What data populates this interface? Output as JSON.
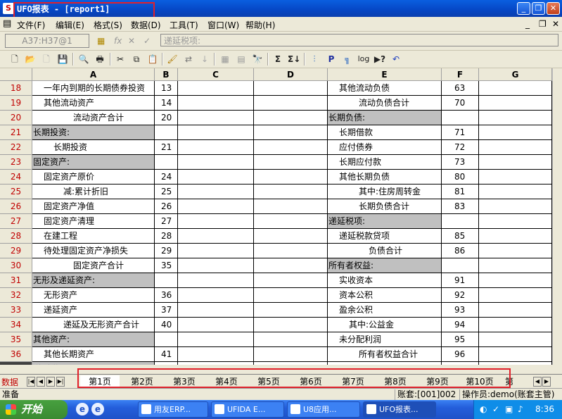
{
  "window": {
    "title": "UFO报表 - [report1]"
  },
  "menu": [
    {
      "label": "文件(F)"
    },
    {
      "label": "编辑(E)"
    },
    {
      "label": "格式(S)"
    },
    {
      "label": "数据(D)"
    },
    {
      "label": "工具(T)"
    },
    {
      "label": "窗口(W)"
    },
    {
      "label": "帮助(H)"
    }
  ],
  "formula_bar": {
    "cell_ref": "A37:H37@1",
    "content": "递延税项:"
  },
  "toolbar_icons": [
    "new-file-icon",
    "open-folder-icon",
    "blank-icon",
    "save-icon",
    "print-preview-icon",
    "print-icon",
    "cut-icon",
    "copy-icon",
    "paste-icon",
    "format-painter-icon",
    "insert-icon",
    "sort-icon",
    "grid-icon",
    "table-icon",
    "find-icon",
    "sum-icon",
    "sum-list-icon",
    "chart-icon",
    "P",
    "pivot-icon",
    "log-icon",
    "help-icon",
    "undo-icon"
  ],
  "grid": {
    "columns": [
      "A",
      "B",
      "C",
      "D",
      "E",
      "F",
      "G"
    ],
    "rows": [
      {
        "n": "18",
        "a": "一年内到期的长期债券投资",
        "ai": 1,
        "ag": false,
        "b": "13",
        "e": "其他流动负债",
        "ei": 1,
        "eg": false,
        "f": "63"
      },
      {
        "n": "19",
        "a": "其他流动资产",
        "ai": 1,
        "ag": false,
        "b": "14",
        "e": "流动负债合计",
        "ei": 3,
        "eg": false,
        "f": "70"
      },
      {
        "n": "20",
        "a": "流动资产合计",
        "ai": 4,
        "ag": false,
        "b": "20",
        "e": "长期负债:",
        "ei": 0,
        "eg": true,
        "f": ""
      },
      {
        "n": "21",
        "a": "长期投资:",
        "ai": 0,
        "ag": true,
        "b": "",
        "e": "长期借款",
        "ei": 1,
        "eg": false,
        "f": "71"
      },
      {
        "n": "22",
        "a": "长期投资",
        "ai": 2,
        "ag": false,
        "b": "21",
        "e": "应付债券",
        "ei": 1,
        "eg": false,
        "f": "72"
      },
      {
        "n": "23",
        "a": "固定资产:",
        "ai": 0,
        "ag": true,
        "b": "",
        "e": "长期应付款",
        "ei": 1,
        "eg": false,
        "f": "73"
      },
      {
        "n": "24",
        "a": "固定资产原价",
        "ai": 1,
        "ag": false,
        "b": "24",
        "e": "其他长期负债",
        "ei": 1,
        "eg": false,
        "f": "80"
      },
      {
        "n": "25",
        "a": "减:累计折旧",
        "ai": 3,
        "ag": false,
        "b": "25",
        "e": "其中:住房周转金",
        "ei": 3,
        "eg": false,
        "f": "81"
      },
      {
        "n": "26",
        "a": "固定资产净值",
        "ai": 1,
        "ag": false,
        "b": "26",
        "e": "长期负债合计",
        "ei": 3,
        "eg": false,
        "f": "83"
      },
      {
        "n": "27",
        "a": "固定资产清理",
        "ai": 1,
        "ag": false,
        "b": "27",
        "e": "递延税项:",
        "ei": 0,
        "eg": true,
        "f": ""
      },
      {
        "n": "28",
        "a": "在建工程",
        "ai": 1,
        "ag": false,
        "b": "28",
        "e": "递延税款贷项",
        "ei": 1,
        "eg": false,
        "f": "85"
      },
      {
        "n": "29",
        "a": "待处理固定资产净损失",
        "ai": 1,
        "ag": false,
        "b": "29",
        "e": "负债合计",
        "ei": 4,
        "eg": false,
        "f": "86"
      },
      {
        "n": "30",
        "a": "固定资产合计",
        "ai": 4,
        "ag": false,
        "b": "35",
        "e": "所有者权益:",
        "ei": 0,
        "eg": true,
        "f": ""
      },
      {
        "n": "31",
        "a": "无形及递延资产:",
        "ai": 0,
        "ag": true,
        "b": "",
        "e": "实收资本",
        "ei": 1,
        "eg": false,
        "f": "91"
      },
      {
        "n": "32",
        "a": "无形资产",
        "ai": 1,
        "ag": false,
        "b": "36",
        "e": "资本公积",
        "ei": 1,
        "eg": false,
        "f": "92"
      },
      {
        "n": "33",
        "a": "递延资产",
        "ai": 1,
        "ag": false,
        "b": "37",
        "e": "盈余公积",
        "ei": 1,
        "eg": false,
        "f": "93"
      },
      {
        "n": "34",
        "a": "递延及无形资产合计",
        "ai": 3,
        "ag": false,
        "b": "40",
        "e": "其中:公益金",
        "ei": 2,
        "eg": false,
        "f": "94"
      },
      {
        "n": "35",
        "a": "其他资产:",
        "ai": 0,
        "ag": true,
        "b": "",
        "e": "未分配利润",
        "ei": 1,
        "eg": false,
        "f": "95"
      },
      {
        "n": "36",
        "a": "其他长期资产",
        "ai": 1,
        "ag": false,
        "b": "41",
        "e": "所有者权益合计",
        "ei": 3,
        "eg": false,
        "f": "96"
      },
      {
        "n": "37",
        "a": "递延税项:",
        "ai": 0,
        "ag": true,
        "b": "",
        "e": "",
        "ei": 0,
        "eg": false,
        "f": ""
      }
    ]
  },
  "tabbar": {
    "mode_label": "数据",
    "sheets": [
      "第1页",
      "第2页",
      "第3页",
      "第4页",
      "第5页",
      "第6页",
      "第7页",
      "第8页",
      "第9页",
      "第10页",
      "第"
    ]
  },
  "status": {
    "ready": "准备",
    "account": "账套:[001]002",
    "operator": "操作员:demo(账套主管)"
  },
  "taskbar": {
    "start": "开始",
    "tasks": [
      "用友ERP...",
      "UFIDA E...",
      "U8应用...",
      "UFO报表..."
    ],
    "clock": "8:36"
  },
  "colors": {
    "accent_red": "#e0202a",
    "row_number": "#c00000",
    "gray_cell": "#c0c0c0"
  }
}
